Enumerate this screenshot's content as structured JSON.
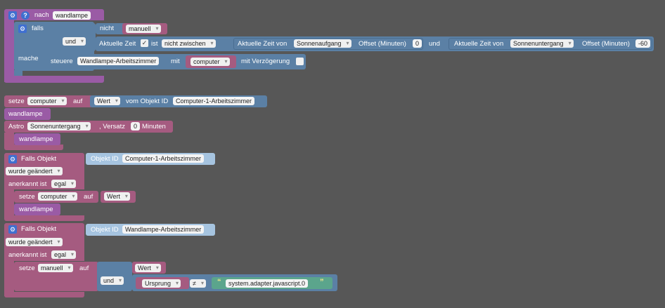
{
  "block1": {
    "nach_label": "nach",
    "name_value": "wandlampe",
    "falls_label": "falls",
    "nicht_label": "nicht",
    "manuell_value": "manuell",
    "und_value": "und",
    "aktuelle_zeit_label": "Aktuelle Zeit",
    "ist_label": "ist",
    "nicht_zwischen_value": "nicht zwischen",
    "akt_zeit_von_1": "Aktuelle Zeit von",
    "sonnenaufgang_value": "Sonnenaufgang",
    "offset_label_1": "Offset (Minuten)",
    "offset_value_1": "0",
    "und_label": "und",
    "akt_zeit_von_2": "Aktuelle Zeit von",
    "sonnenuntergang_value": "Sonnenuntergang",
    "offset_label_2": "Offset (Minuten)",
    "offset_value_2": "-60",
    "mache_label": "mache",
    "steuere_label": "steuere",
    "steuere_target": "Wandlampe-Arbeitszimmer",
    "mit_label": "mit",
    "mit_value": "computer",
    "verzoegerung_label": "mit Verzögerung"
  },
  "block2": {
    "setze_label": "setze",
    "var_value": "computer",
    "auf_label": "auf",
    "wert_value": "Wert",
    "vom_objekt_label": "vom Objekt ID",
    "objekt_value": "Computer-1-Arbeitszimmer"
  },
  "block3": {
    "label": "wandlampe"
  },
  "block4": {
    "astro_label": "Astro",
    "astro_value": "Sonnenuntergang",
    "versatz_label": ", Versatz",
    "versatz_value": "0",
    "minuten_label": "Minuten",
    "inner_label": "wandlampe"
  },
  "block5": {
    "falls_objekt_label": "Falls Objekt",
    "objekt_id_label": "Objekt ID",
    "objekt_id_value": "Computer-1-Arbeitszimmer",
    "wurde_value": "wurde geändert",
    "anerkannt_label": "anerkannt ist",
    "egal_value": "egal",
    "setze_label": "setze",
    "var_value": "computer",
    "auf_label": "auf",
    "wert_value": "Wert",
    "inner_label": "wandlampe"
  },
  "block6": {
    "falls_objekt_label": "Falls Objekt",
    "objekt_id_label": "Objekt ID",
    "objekt_id_value": "Wandlampe-Arbeitszimmer",
    "wurde_value": "wurde geändert",
    "anerkannt_label": "anerkannt ist",
    "egal_value": "egal",
    "setze_label": "setze",
    "var_value": "manuell",
    "auf_label": "auf",
    "wert_value": "Wert",
    "und_value": "und",
    "ursprung_value": "Ursprung",
    "neq_value": "≠",
    "string_value": "system.adapter.javascript.0",
    "quote_open": "“",
    "quote_close": "”"
  },
  "icons": {
    "gear": "⚙",
    "question": "?",
    "check": "✓"
  }
}
